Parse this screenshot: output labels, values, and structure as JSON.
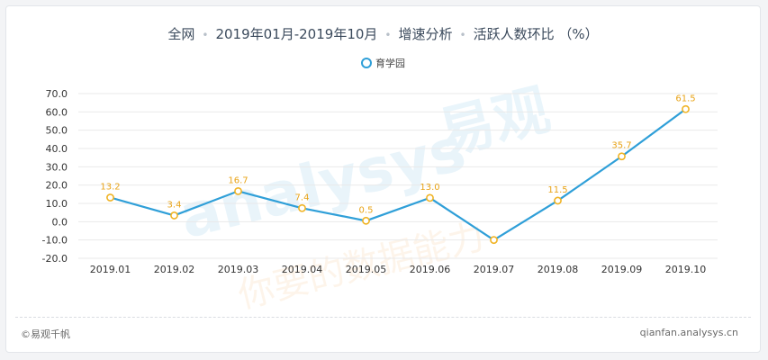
{
  "header": {
    "part1": "全网",
    "part2": "2019年01月-2019年10月",
    "part3": "增速分析",
    "part4": "活跃人数环比 （%）"
  },
  "watermark": {
    "brand_latin": "analysys",
    "brand_cn": "易观",
    "slogan": "你要的数据能力"
  },
  "footer": {
    "left": "©易观千帆",
    "right": "qianfan.analysys.cn"
  },
  "colors": {
    "line": "#2f9fd8",
    "point_fill": "#ffffff",
    "point_stroke": "#f0b323",
    "label": "#e8a317",
    "axis_text": "#333333",
    "grid": "#e9e9e9"
  },
  "chart_data": {
    "type": "line",
    "categories": [
      "2019.01",
      "2019.02",
      "2019.03",
      "2019.04",
      "2019.05",
      "2019.06",
      "2019.07",
      "2019.08",
      "2019.09",
      "2019.10"
    ],
    "series": [
      {
        "name": "育学园",
        "values": [
          13.2,
          3.4,
          16.7,
          7.4,
          0.5,
          13.0,
          -10.0,
          11.5,
          35.7,
          61.5
        ]
      }
    ],
    "data_labels": [
      "13.2",
      "3.4",
      "16.7",
      "7.4",
      "0.5",
      "13.0",
      "",
      "11.5",
      "35.7",
      "61.5"
    ],
    "yticks": [
      "70.0",
      "60.0",
      "50.0",
      "40.0",
      "30.0",
      "20.0",
      "10.0",
      "0.0",
      "-10.0",
      "-20.0"
    ],
    "ylim": [
      -20,
      70
    ],
    "grid": true,
    "legend_position": "top-center"
  }
}
